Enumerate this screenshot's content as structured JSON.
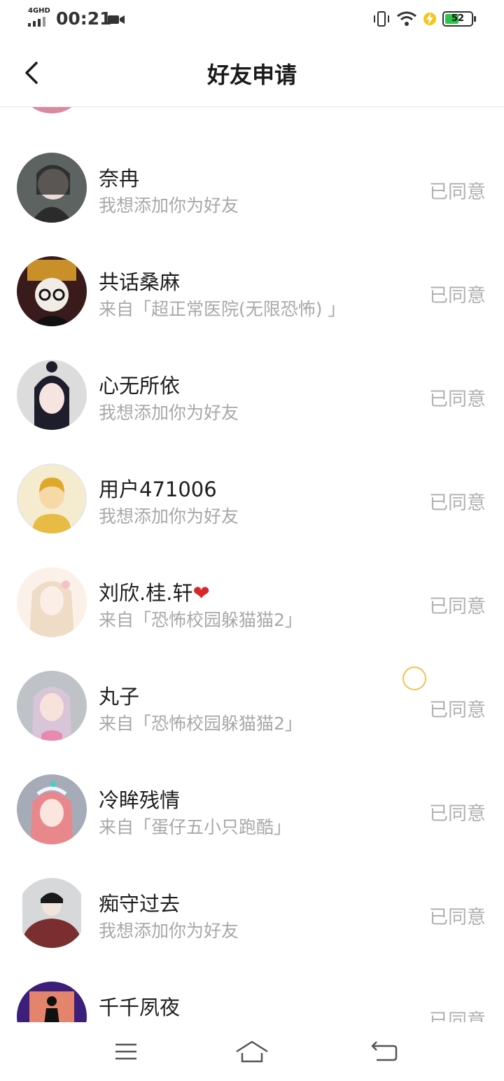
{
  "status_bar": {
    "network": "4GHD",
    "time": "00:21",
    "battery": "52",
    "battery_level": 0.52,
    "icons": [
      "signal-icon",
      "video-camera-icon",
      "vibrate-icon",
      "wifi-icon",
      "charging-icon",
      "battery-icon"
    ]
  },
  "header": {
    "title": "好友申请",
    "back_icon": "chevron-left-icon"
  },
  "requests": [
    {
      "name": "奈冉",
      "message": "我想添加你为好友",
      "status": "已同意"
    },
    {
      "name": "共话桑麻",
      "message": "来自「超正常医院(无限恐怖) 」",
      "status": "已同意"
    },
    {
      "name": "心无所依",
      "message": "我想添加你为好友",
      "status": "已同意"
    },
    {
      "name": "用户471006",
      "message": "我想添加你为好友",
      "status": "已同意"
    },
    {
      "name": "刘欣.桂.轩",
      "name_suffix": "❤",
      "message": "来自「恐怖校园躲猫猫2」",
      "status": "已同意"
    },
    {
      "name": "丸子",
      "message": "来自「恐怖校园躲猫猫2」",
      "status": "已同意"
    },
    {
      "name": "冷眸残情",
      "message": "来自「蛋仔五小只跑酷」",
      "status": "已同意"
    },
    {
      "name": "痴守过去",
      "message": "我想添加你为好友",
      "status": "已同意"
    },
    {
      "name": "千千夙夜",
      "message": "",
      "status": "已同意"
    }
  ],
  "nav_bar": {
    "icons": [
      "menu-icon",
      "home-icon",
      "back-icon"
    ]
  },
  "colors": {
    "accent_battery": "#2ec44a",
    "secondary_text": "#a8a8a8",
    "status_text": "#b0b0b0",
    "heart": "#d9262a"
  }
}
